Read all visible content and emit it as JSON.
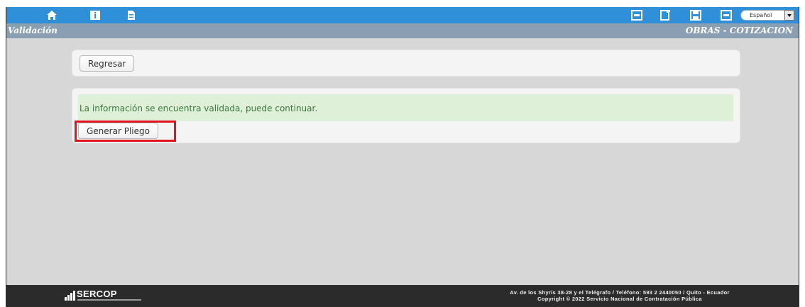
{
  "toolbar": {
    "icons": [
      "home-icon",
      "info-icon",
      "document-icon",
      "pdf-icon",
      "new-document-icon",
      "save-icon",
      "pdf-icon"
    ],
    "language_selected": "Español"
  },
  "titlebar": {
    "left": "Validación",
    "right": "OBRAS - COTIZACION"
  },
  "actions": {
    "back_label": "Regresar",
    "generate_label": "Generar Pliego"
  },
  "alert": {
    "message": "La información se encuentra validada, puede continuar."
  },
  "footer": {
    "logo_text": "SERCOP",
    "address": "Av. de los Shyris 38-28 y el Telégrafo / Teléfono: 593 2 2440050 / Quito - Ecuador",
    "copyright": "Copyright © 2022 Servicio Nacional de Contratación Pública"
  },
  "colors": {
    "toolbar": "#2f8fd8",
    "titlebar": "#8aa0b2",
    "alert_bg": "#dff0d8",
    "alert_text": "#3c763d",
    "highlight": "#e0141e",
    "footer": "#2b2b2b"
  }
}
